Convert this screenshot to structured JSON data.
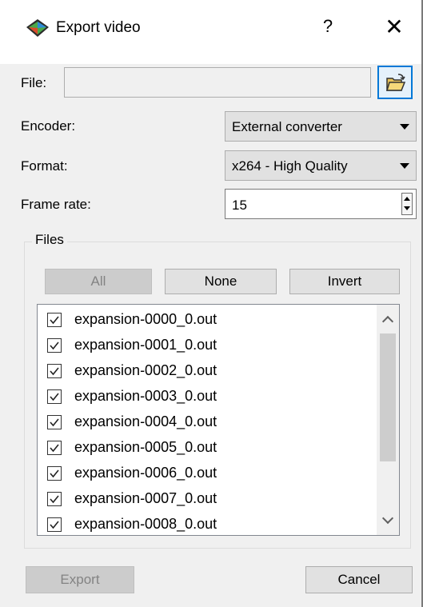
{
  "window": {
    "title": "Export video",
    "help_label": "?",
    "close_label": "✕"
  },
  "form": {
    "file_label": "File:",
    "file_value": "",
    "encoder_label": "Encoder:",
    "encoder_value": "External converter",
    "format_label": "Format:",
    "format_value": "x264 - High Quality",
    "frame_rate_label": "Frame rate:",
    "frame_rate_value": "15"
  },
  "files_group": {
    "title": "Files",
    "all_label": "All",
    "none_label": "None",
    "invert_label": "Invert",
    "items": [
      {
        "name": "expansion-0000_0.out",
        "checked": true
      },
      {
        "name": "expansion-0001_0.out",
        "checked": true
      },
      {
        "name": "expansion-0002_0.out",
        "checked": true
      },
      {
        "name": "expansion-0003_0.out",
        "checked": true
      },
      {
        "name": "expansion-0004_0.out",
        "checked": true
      },
      {
        "name": "expansion-0005_0.out",
        "checked": true
      },
      {
        "name": "expansion-0006_0.out",
        "checked": true
      },
      {
        "name": "expansion-0007_0.out",
        "checked": true
      },
      {
        "name": "expansion-0008_0.out",
        "checked": true
      }
    ]
  },
  "footer": {
    "export_label": "Export",
    "cancel_label": "Cancel"
  },
  "icons": {
    "app": "app-logo-icon",
    "browse": "folder-open-icon",
    "checkbox": "checkmark-icon"
  }
}
